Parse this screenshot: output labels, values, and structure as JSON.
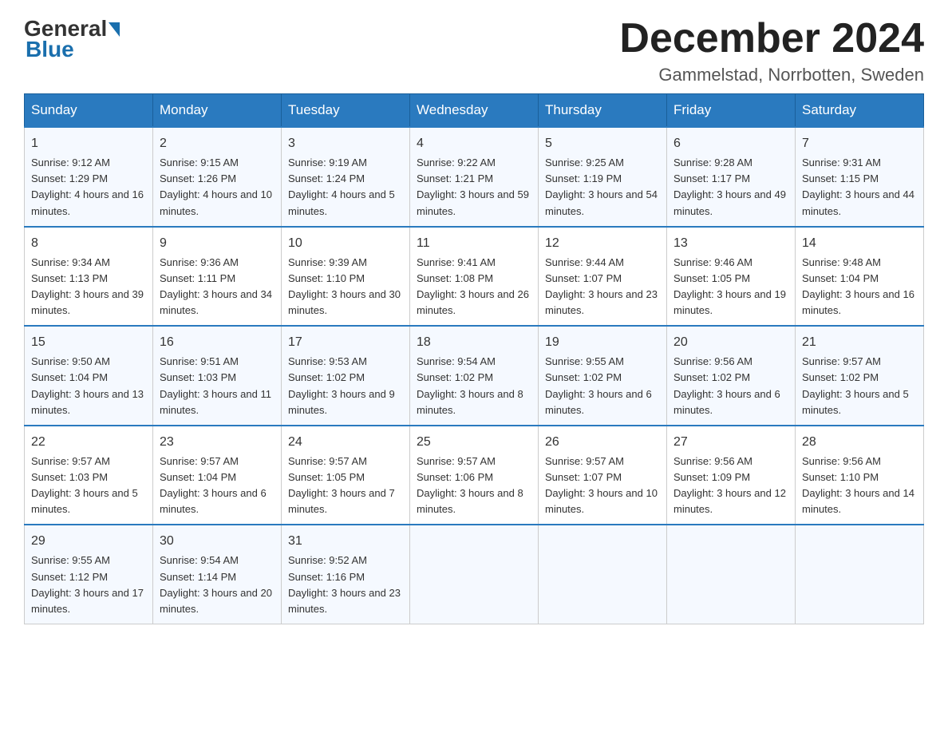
{
  "logo": {
    "general": "General",
    "blue": "Blue"
  },
  "title": "December 2024",
  "location": "Gammelstad, Norrbotten, Sweden",
  "weekdays": [
    "Sunday",
    "Monday",
    "Tuesday",
    "Wednesday",
    "Thursday",
    "Friday",
    "Saturday"
  ],
  "weeks": [
    [
      {
        "day": "1",
        "sunrise": "9:12 AM",
        "sunset": "1:29 PM",
        "daylight": "4 hours and 16 minutes."
      },
      {
        "day": "2",
        "sunrise": "9:15 AM",
        "sunset": "1:26 PM",
        "daylight": "4 hours and 10 minutes."
      },
      {
        "day": "3",
        "sunrise": "9:19 AM",
        "sunset": "1:24 PM",
        "daylight": "4 hours and 5 minutes."
      },
      {
        "day": "4",
        "sunrise": "9:22 AM",
        "sunset": "1:21 PM",
        "daylight": "3 hours and 59 minutes."
      },
      {
        "day": "5",
        "sunrise": "9:25 AM",
        "sunset": "1:19 PM",
        "daylight": "3 hours and 54 minutes."
      },
      {
        "day": "6",
        "sunrise": "9:28 AM",
        "sunset": "1:17 PM",
        "daylight": "3 hours and 49 minutes."
      },
      {
        "day": "7",
        "sunrise": "9:31 AM",
        "sunset": "1:15 PM",
        "daylight": "3 hours and 44 minutes."
      }
    ],
    [
      {
        "day": "8",
        "sunrise": "9:34 AM",
        "sunset": "1:13 PM",
        "daylight": "3 hours and 39 minutes."
      },
      {
        "day": "9",
        "sunrise": "9:36 AM",
        "sunset": "1:11 PM",
        "daylight": "3 hours and 34 minutes."
      },
      {
        "day": "10",
        "sunrise": "9:39 AM",
        "sunset": "1:10 PM",
        "daylight": "3 hours and 30 minutes."
      },
      {
        "day": "11",
        "sunrise": "9:41 AM",
        "sunset": "1:08 PM",
        "daylight": "3 hours and 26 minutes."
      },
      {
        "day": "12",
        "sunrise": "9:44 AM",
        "sunset": "1:07 PM",
        "daylight": "3 hours and 23 minutes."
      },
      {
        "day": "13",
        "sunrise": "9:46 AM",
        "sunset": "1:05 PM",
        "daylight": "3 hours and 19 minutes."
      },
      {
        "day": "14",
        "sunrise": "9:48 AM",
        "sunset": "1:04 PM",
        "daylight": "3 hours and 16 minutes."
      }
    ],
    [
      {
        "day": "15",
        "sunrise": "9:50 AM",
        "sunset": "1:04 PM",
        "daylight": "3 hours and 13 minutes."
      },
      {
        "day": "16",
        "sunrise": "9:51 AM",
        "sunset": "1:03 PM",
        "daylight": "3 hours and 11 minutes."
      },
      {
        "day": "17",
        "sunrise": "9:53 AM",
        "sunset": "1:02 PM",
        "daylight": "3 hours and 9 minutes."
      },
      {
        "day": "18",
        "sunrise": "9:54 AM",
        "sunset": "1:02 PM",
        "daylight": "3 hours and 8 minutes."
      },
      {
        "day": "19",
        "sunrise": "9:55 AM",
        "sunset": "1:02 PM",
        "daylight": "3 hours and 6 minutes."
      },
      {
        "day": "20",
        "sunrise": "9:56 AM",
        "sunset": "1:02 PM",
        "daylight": "3 hours and 6 minutes."
      },
      {
        "day": "21",
        "sunrise": "9:57 AM",
        "sunset": "1:02 PM",
        "daylight": "3 hours and 5 minutes."
      }
    ],
    [
      {
        "day": "22",
        "sunrise": "9:57 AM",
        "sunset": "1:03 PM",
        "daylight": "3 hours and 5 minutes."
      },
      {
        "day": "23",
        "sunrise": "9:57 AM",
        "sunset": "1:04 PM",
        "daylight": "3 hours and 6 minutes."
      },
      {
        "day": "24",
        "sunrise": "9:57 AM",
        "sunset": "1:05 PM",
        "daylight": "3 hours and 7 minutes."
      },
      {
        "day": "25",
        "sunrise": "9:57 AM",
        "sunset": "1:06 PM",
        "daylight": "3 hours and 8 minutes."
      },
      {
        "day": "26",
        "sunrise": "9:57 AM",
        "sunset": "1:07 PM",
        "daylight": "3 hours and 10 minutes."
      },
      {
        "day": "27",
        "sunrise": "9:56 AM",
        "sunset": "1:09 PM",
        "daylight": "3 hours and 12 minutes."
      },
      {
        "day": "28",
        "sunrise": "9:56 AM",
        "sunset": "1:10 PM",
        "daylight": "3 hours and 14 minutes."
      }
    ],
    [
      {
        "day": "29",
        "sunrise": "9:55 AM",
        "sunset": "1:12 PM",
        "daylight": "3 hours and 17 minutes."
      },
      {
        "day": "30",
        "sunrise": "9:54 AM",
        "sunset": "1:14 PM",
        "daylight": "3 hours and 20 minutes."
      },
      {
        "day": "31",
        "sunrise": "9:52 AM",
        "sunset": "1:16 PM",
        "daylight": "3 hours and 23 minutes."
      },
      {
        "day": "",
        "sunrise": "",
        "sunset": "",
        "daylight": ""
      },
      {
        "day": "",
        "sunrise": "",
        "sunset": "",
        "daylight": ""
      },
      {
        "day": "",
        "sunrise": "",
        "sunset": "",
        "daylight": ""
      },
      {
        "day": "",
        "sunrise": "",
        "sunset": "",
        "daylight": ""
      }
    ]
  ]
}
